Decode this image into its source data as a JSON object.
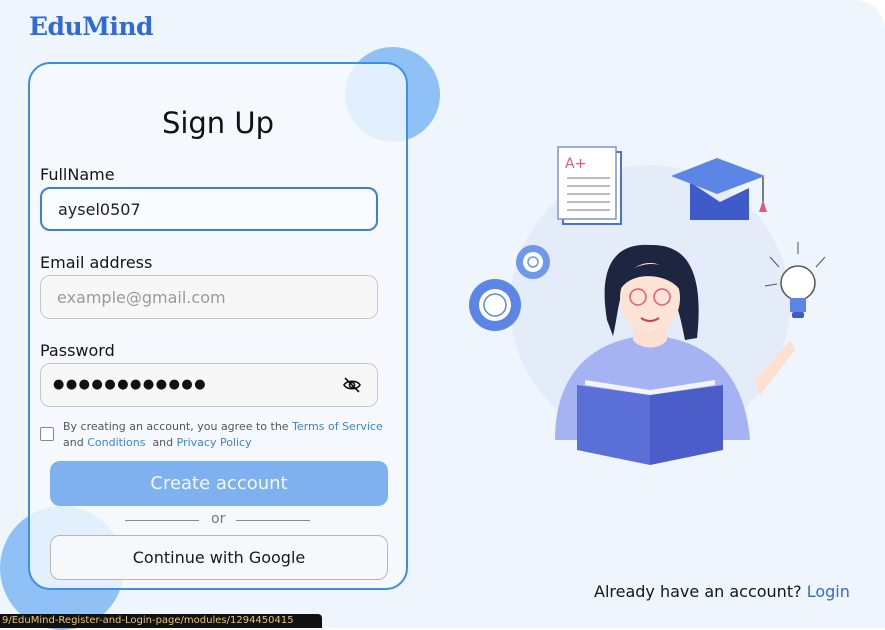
{
  "brand": {
    "logo_text": "EduMind"
  },
  "form": {
    "title": "Sign Up",
    "fullname": {
      "label": "FullName",
      "value": "aysel0507"
    },
    "email": {
      "label": "Email address",
      "placeholder": "example@gmail.com"
    },
    "password": {
      "label": "Password",
      "masked_value": "●●●●●●●●●●●●",
      "toggle_icon": "eye-slash-icon"
    },
    "terms": {
      "prefix": "By creating an account, you agree to the",
      "terms_link": "Terms of Service",
      "and1": "and",
      "conditions_link": "Conditions",
      "and2": "and",
      "privacy_link": "Privacy Policy"
    },
    "create_button": "Create account",
    "or_text": "or",
    "google_button": "Continue with Google"
  },
  "footer": {
    "already_text": "Already have an account?",
    "login_link": "Login"
  },
  "status_url": "9/EduMind-Register-and-Login-page/modules/1294450415",
  "colors": {
    "accent": "#2f6ad6",
    "button": "#7fb0f0",
    "card_border": "#3e8ee6",
    "background": "#eef5fd"
  }
}
